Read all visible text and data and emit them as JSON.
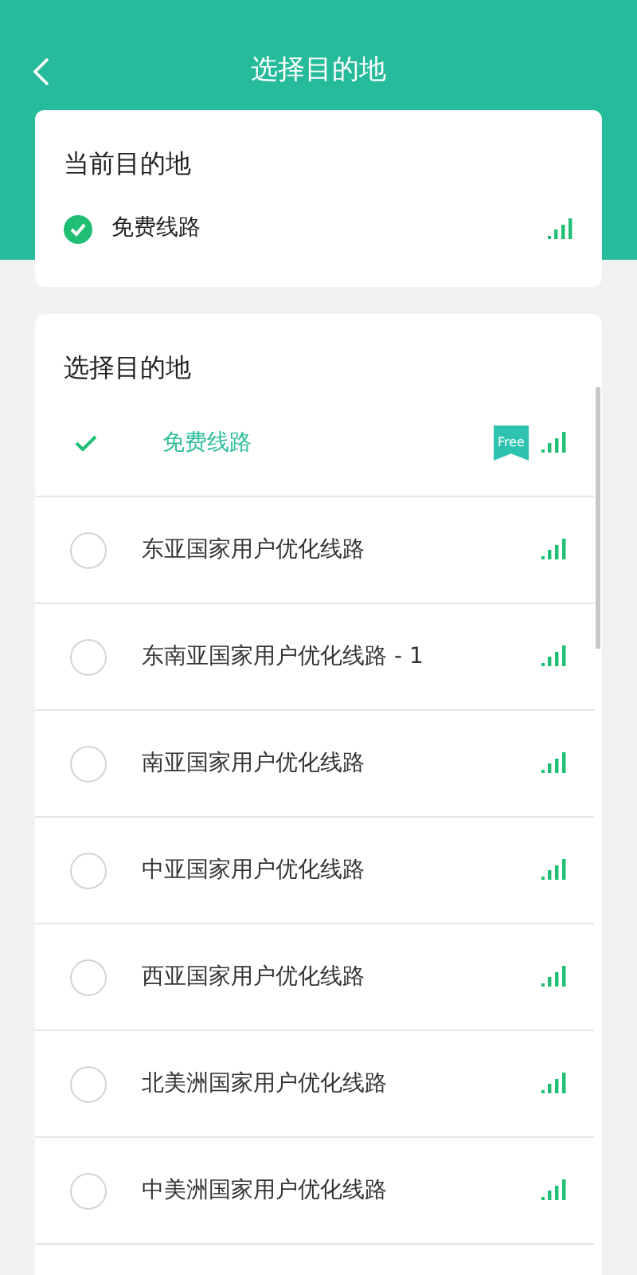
{
  "header": {
    "title": "选择目的地"
  },
  "current": {
    "title": "当前目的地",
    "route": "免费线路"
  },
  "list": {
    "title": "选择目的地",
    "items": [
      {
        "label": "免费线路",
        "selected": true,
        "badge": "Free"
      },
      {
        "label": "东亚国家用户优化线路",
        "selected": false
      },
      {
        "label": "东南亚国家用户优化线路 - 1",
        "selected": false
      },
      {
        "label": "南亚国家用户优化线路",
        "selected": false
      },
      {
        "label": "中亚国家用户优化线路",
        "selected": false
      },
      {
        "label": "西亚国家用户优化线路",
        "selected": false
      },
      {
        "label": "北美洲国家用户优化线路",
        "selected": false
      },
      {
        "label": "中美洲国家用户优化线路",
        "selected": false
      }
    ]
  }
}
